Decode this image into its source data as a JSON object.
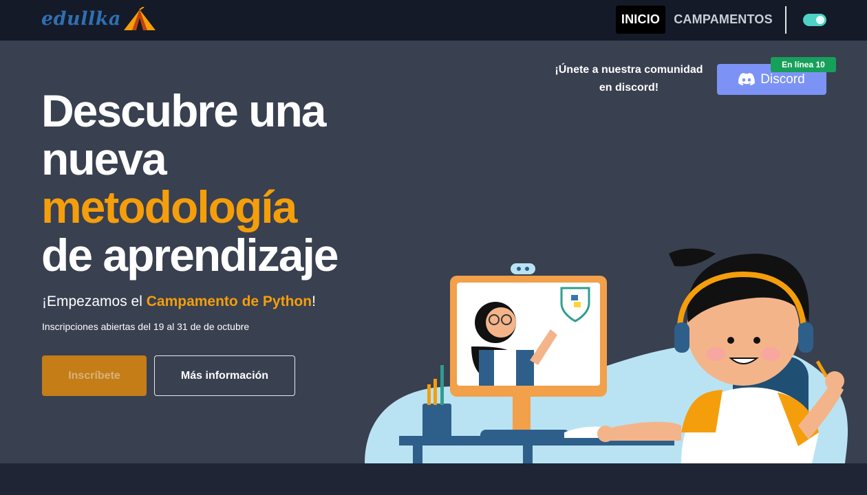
{
  "nav": {
    "logo_text": "edullka",
    "items": [
      {
        "label": "INICIO",
        "active": true
      },
      {
        "label": "CAMPAMENTOS",
        "active": false
      }
    ],
    "theme_toggle_on": true
  },
  "hero": {
    "headline": {
      "line1": "Descubre una",
      "line2": "nueva",
      "line3_highlight": "metodología",
      "line4": "de aprendizaje"
    },
    "subline": {
      "prefix": "¡Empezamos el ",
      "highlight": "Campamento de Python",
      "suffix": "!"
    },
    "dates": "Inscripciones abiertas del 19 al 31 de de octubre",
    "primary_button": "Inscríbete",
    "secondary_button": "Más información"
  },
  "community": {
    "text": "¡Únete a nuestra comunidad en discord!",
    "discord_label": "Discord",
    "online_badge": "En línea 10"
  },
  "colors": {
    "accent": "#f59e0b",
    "nav_bg": "#141a27",
    "hero_bg": "#394050",
    "discord": "#7c93f5",
    "online": "#16a05a",
    "toggle": "#4fd1c5"
  }
}
